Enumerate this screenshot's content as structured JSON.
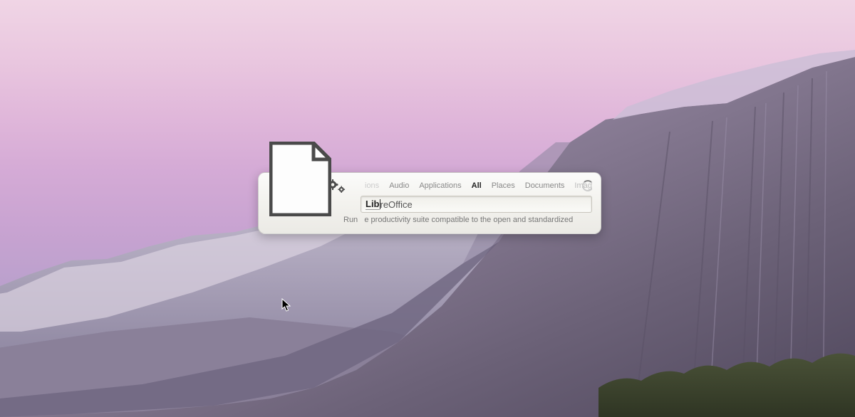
{
  "launcher": {
    "categories": [
      {
        "label": "Actions",
        "active": false,
        "truncated": true
      },
      {
        "label": "Audio",
        "active": false
      },
      {
        "label": "Applications",
        "active": false
      },
      {
        "label": "All",
        "active": true
      },
      {
        "label": "Places",
        "active": false
      },
      {
        "label": "Documents",
        "active": false
      },
      {
        "label": "Images",
        "active": false,
        "truncated_end": true
      }
    ],
    "search": {
      "typed": "Lib",
      "completion": "reOffice"
    },
    "result": {
      "action": "Run",
      "description_fragment": "e productivity suite compatible to the open and standardized",
      "full_display": "Run   e productivity suite compatible to the open and standardized"
    },
    "app_icon_name": "libreoffice-document-icon"
  }
}
